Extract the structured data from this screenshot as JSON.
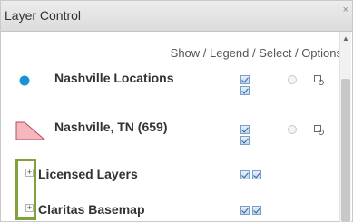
{
  "window": {
    "title": "Layer Control",
    "close_label": "×"
  },
  "header": {
    "options_label": "Show / Legend / Select / Options"
  },
  "layers": [
    {
      "label": "Nashville Locations",
      "legend_color": "#1a93d6"
    },
    {
      "label": "Nashville, TN (659)",
      "legend_color": "#f6b6be"
    }
  ],
  "groups": [
    {
      "label": "Licensed Layers",
      "expander": "+"
    },
    {
      "label": "Claritas Basemap",
      "expander": "+"
    }
  ],
  "scrollbar": {
    "arrow_up": "▲"
  },
  "colors": {
    "highlight_border": "#7fa33a",
    "checkbox_check": "#2f5f9a"
  }
}
